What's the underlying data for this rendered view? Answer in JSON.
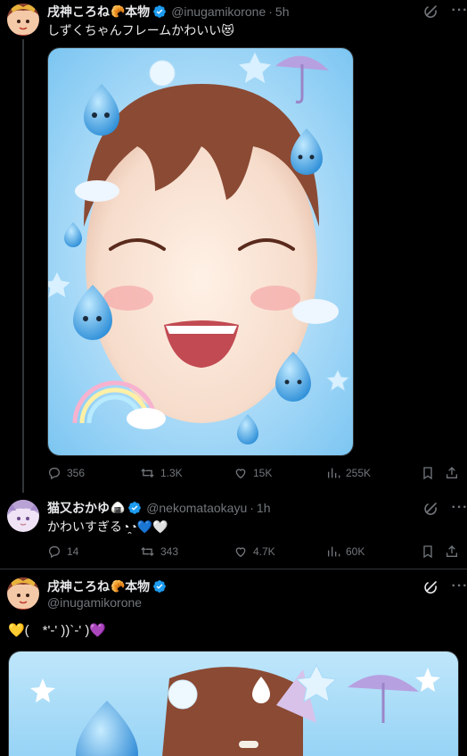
{
  "tweet1": {
    "display_name": "戌神ころね",
    "name_emoji": "🥐",
    "name_suffix": "本物",
    "handle": "@inugamikorone",
    "sep": "·",
    "time": "5h",
    "text": "しずくちゃんフレームかわいい😻",
    "stats": {
      "replies": "356",
      "retweets": "1.3K",
      "likes": "15K",
      "views": "255K"
    }
  },
  "reply": {
    "display_name": "猫又おかゆ",
    "name_emoji": "🍙",
    "handle": "@nekomataokayu",
    "sep": "·",
    "time": "1h",
    "text": "かわいすぎる◔̯◔💙🤍",
    "stats": {
      "replies": "14",
      "retweets": "343",
      "likes": "4.7K",
      "views": "60K"
    }
  },
  "tweet2": {
    "display_name": "戌神ころね",
    "name_emoji": "🥐",
    "name_suffix": "本物",
    "handle": "@inugamikorone",
    "text": "💛(　*'-' ))`-' )💜"
  },
  "icons": {
    "verified": "verified-badge-icon",
    "grok": "grok-icon",
    "more": "more-icon",
    "reply": "reply-icon",
    "retweet": "retweet-icon",
    "like": "like-icon",
    "views": "views-icon",
    "bookmark": "bookmark-icon",
    "share": "share-icon"
  },
  "colors": {
    "verified": "#1d9bf0",
    "muted": "#71767b",
    "text": "#e7e9ea",
    "background": "#000000"
  }
}
